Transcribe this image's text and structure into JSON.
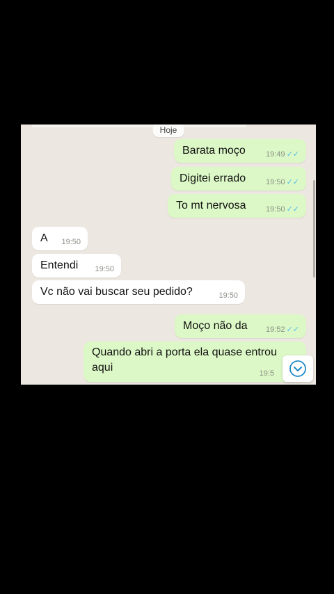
{
  "chat": {
    "date_label": "Hoje",
    "messages": [
      {
        "direction": "out",
        "text": "Barata moço",
        "time": "19:49",
        "ticks": "✓✓"
      },
      {
        "direction": "out",
        "text": "Digitei errado",
        "time": "19:50",
        "ticks": "✓✓"
      },
      {
        "direction": "out",
        "text": "To mt nervosa",
        "time": "19:50",
        "ticks": "✓✓"
      },
      {
        "direction": "in",
        "text": "A",
        "time": "19:50"
      },
      {
        "direction": "in",
        "text": "Entendi",
        "time": "19:50"
      },
      {
        "direction": "in",
        "text": "Vc não vai buscar seu pedido?",
        "time": "19:50"
      },
      {
        "direction": "out",
        "text": "Moço não da",
        "time": "19:52",
        "ticks": "✓✓"
      },
      {
        "direction": "out",
        "text": "Quando abri a porta ela quase entrou aqui",
        "time": "19:5"
      }
    ],
    "scroll_button_icon": "chevron-down-icon",
    "colors": {
      "outgoing_bubble": "#dcf8c6",
      "incoming_bubble": "#ffffff",
      "read_ticks": "#53bdeb",
      "chat_background": "#ece7e0"
    }
  }
}
